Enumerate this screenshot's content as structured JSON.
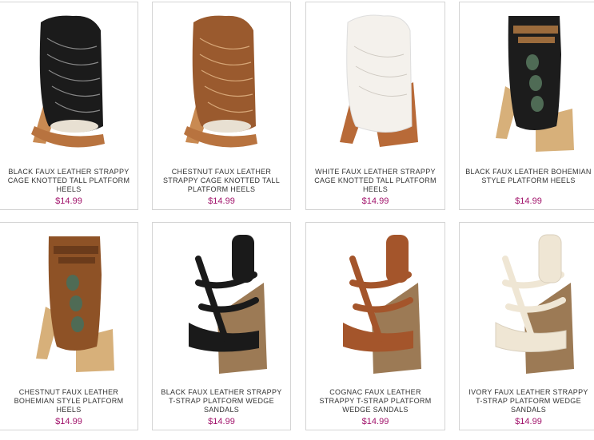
{
  "colors": {
    "price": "#a1136b",
    "border": "#d4d4d4",
    "name_text": "#333333"
  },
  "products": [
    {
      "name": "BLACK FAUX LEATHER STRAPPY CAGE KNOTTED TALL PLATFORM HEELS",
      "price": "$14.99",
      "icon": "shoe-image-black-cage-heel",
      "upper_color": "#1b1b1b",
      "sole_color": "#c98a52"
    },
    {
      "name": "CHESTNUT FAUX LEATHER STRAPPY CAGE KNOTTED TALL PLATFORM HEELS",
      "price": "$14.99",
      "icon": "shoe-image-chestnut-cage-heel",
      "upper_color": "#9a5a2e",
      "sole_color": "#c98a52"
    },
    {
      "name": "WHITE FAUX LEATHER STRAPPY CAGE KNOTTED TALL PLATFORM HEELS",
      "price": "$14.99",
      "icon": "shoe-image-white-cage-heel",
      "upper_color": "#f4f1ec",
      "sole_color": "#b86a38"
    },
    {
      "name": "BLACK FAUX LEATHER BOHEMIAN STYLE PLATFORM HEELS",
      "price": "$14.99",
      "icon": "shoe-image-black-bohemian-heel",
      "upper_color": "#1c1c1c",
      "sole_color": "#d7b07a"
    },
    {
      "name": "CHESTNUT FAUX LEATHER BOHEMIAN STYLE PLATFORM HEELS",
      "price": "$14.99",
      "icon": "shoe-image-chestnut-bohemian-heel",
      "upper_color": "#8e5226",
      "sole_color": "#d7b07a"
    },
    {
      "name": "BLACK FAUX LEATHER STRAPPY T-STRAP PLATFORM WEDGE SANDALS",
      "price": "$14.99",
      "icon": "shoe-image-black-tstrap-wedge",
      "upper_color": "#1a1a1a",
      "sole_color": "#9c7a55"
    },
    {
      "name": "COGNAC FAUX LEATHER STRAPPY T-STRAP PLATFORM WEDGE SANDALS",
      "price": "$14.99",
      "icon": "shoe-image-cognac-tstrap-wedge",
      "upper_color": "#a4552b",
      "sole_color": "#9c7a55"
    },
    {
      "name": "IVORY FAUX LEATHER STRAPPY T-STRAP PLATFORM WEDGE SANDALS",
      "price": "$14.99",
      "icon": "shoe-image-ivory-tstrap-wedge",
      "upper_color": "#efe6d4",
      "sole_color": "#9c7a55"
    }
  ]
}
